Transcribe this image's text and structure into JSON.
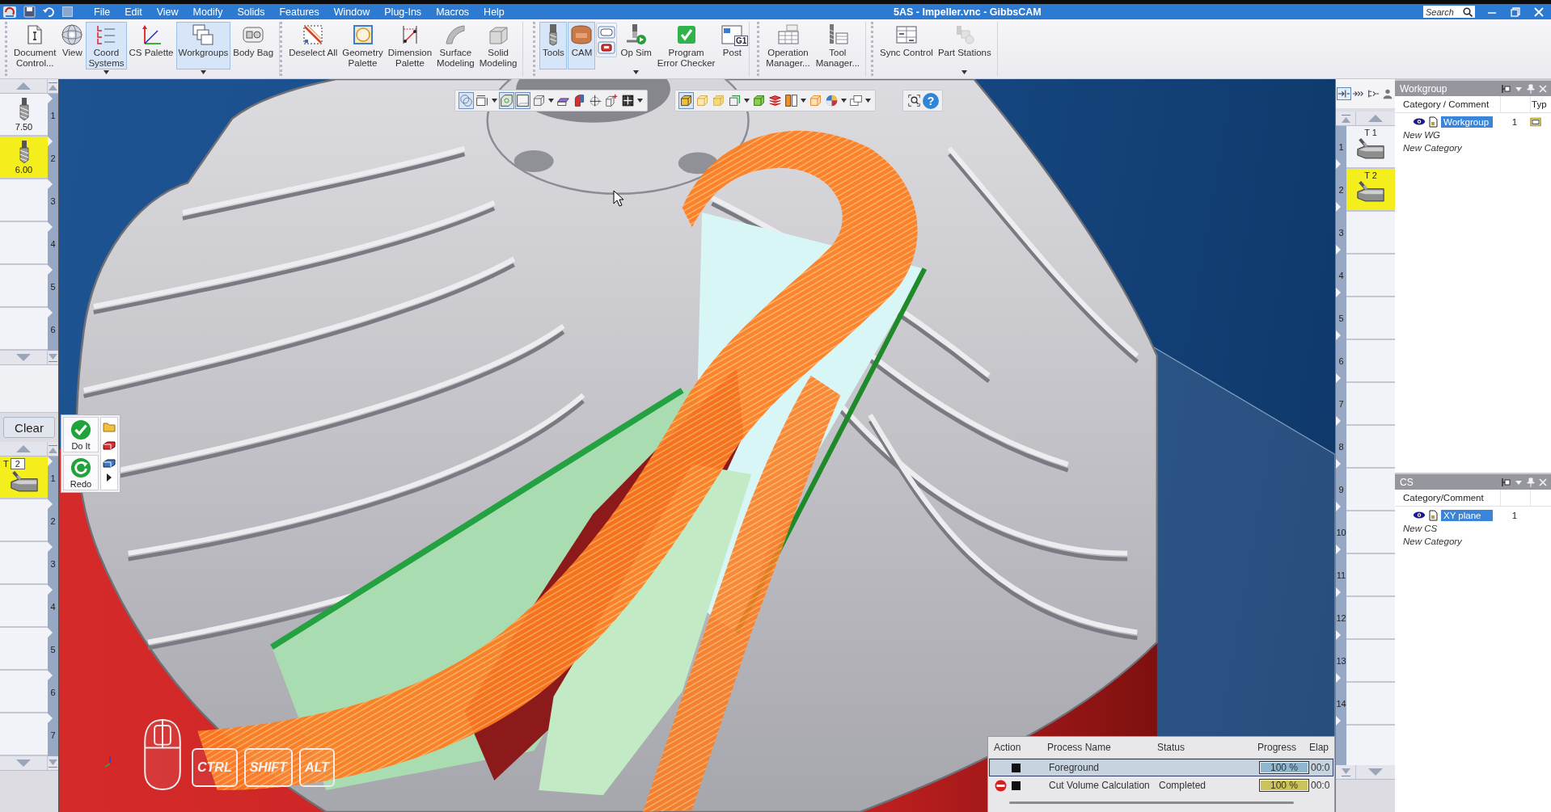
{
  "title_bar": {
    "menu": [
      "File",
      "Edit",
      "View",
      "Modify",
      "Solids",
      "Features",
      "Window",
      "Plug-Ins",
      "Macros",
      "Help"
    ],
    "title": "5AS - Impeller.vnc - GibbsCAM",
    "search": {
      "placeholder": "Search"
    }
  },
  "ribbon": {
    "groups": [
      {
        "items": [
          {
            "kind": "button",
            "label": "Document\nControl...",
            "on": false,
            "dropdown": false
          },
          {
            "kind": "button",
            "label": "View",
            "on": false,
            "dropdown": false
          },
          {
            "kind": "button",
            "label": "Coord\nSystems",
            "on": true,
            "dropdown": true
          },
          {
            "kind": "button",
            "label": "CS Palette",
            "on": false,
            "dropdown": false
          },
          {
            "kind": "button",
            "label": "Workgroups",
            "on": true,
            "dropdown": true
          },
          {
            "kind": "button",
            "label": "Body Bag",
            "on": false,
            "dropdown": false
          }
        ]
      },
      {
        "items": [
          {
            "kind": "button",
            "label": "Deselect All",
            "on": false,
            "dropdown": false
          },
          {
            "kind": "button",
            "label": "Geometry\nPalette",
            "on": false,
            "dropdown": false
          },
          {
            "kind": "button",
            "label": "Dimension\nPalette",
            "on": false,
            "dropdown": false
          },
          {
            "kind": "button",
            "label": "Surface\nModeling",
            "on": false,
            "dropdown": false
          },
          {
            "kind": "button",
            "label": "Solid\nModeling",
            "on": false,
            "dropdown": false
          }
        ]
      },
      {
        "items": [
          {
            "kind": "button",
            "label": "Tools",
            "on": true,
            "dropdown": false
          },
          {
            "kind": "button",
            "label": "CAM",
            "on": true,
            "dropdown": false
          },
          {
            "kind": "icon_stack",
            "on": false,
            "dropdown": false
          },
          {
            "kind": "button",
            "label": "Op Sim",
            "on": false,
            "dropdown": true
          },
          {
            "kind": "button",
            "label": "Program\nError Checker",
            "on": false,
            "dropdown": false
          },
          {
            "kind": "button",
            "label": "Post",
            "badge": "G1",
            "on": false,
            "dropdown": false
          }
        ]
      },
      {
        "items": [
          {
            "kind": "button",
            "label": "Operation\nManager...",
            "on": false,
            "dropdown": false
          },
          {
            "kind": "button",
            "label": "Tool\nManager...",
            "on": false,
            "dropdown": false
          }
        ]
      },
      {
        "items": [
          {
            "kind": "button",
            "label": "Sync Control",
            "on": false,
            "dropdown": false
          },
          {
            "kind": "button",
            "label": "Part Stations",
            "on": false,
            "dropdown": true
          }
        ]
      }
    ]
  },
  "tool_list": {
    "items": [
      {
        "kind": "tool",
        "number": "1",
        "diameter": "7.50",
        "selected": false
      },
      {
        "kind": "tool",
        "number": "2",
        "diameter": "6.00",
        "selected": true
      },
      {
        "kind": "empty",
        "number": "3",
        "selected": false
      },
      {
        "kind": "empty",
        "number": "4",
        "selected": false
      },
      {
        "kind": "empty",
        "number": "5",
        "selected": false
      },
      {
        "kind": "empty",
        "number": "6",
        "selected": false
      }
    ]
  },
  "clear_button": {
    "label": "Clear"
  },
  "action_palette": {
    "buttons": [
      {
        "label": "Do It"
      },
      {
        "label": "Redo"
      }
    ]
  },
  "operation_list": {
    "items": [
      {
        "kind": "operation",
        "number": "1",
        "tool_prefix": "T",
        "tool_number": "2",
        "selected": true
      },
      {
        "kind": "empty",
        "number": "2",
        "selected": false
      },
      {
        "kind": "empty",
        "number": "3",
        "selected": false
      },
      {
        "kind": "empty",
        "number": "4",
        "selected": false
      },
      {
        "kind": "empty",
        "number": "5",
        "selected": false
      },
      {
        "kind": "empty",
        "number": "6",
        "selected": false
      },
      {
        "kind": "empty",
        "number": "7",
        "selected": false
      }
    ]
  },
  "viewport": {
    "view_toolbar": {
      "groups": [
        {
          "items": [
            {
              "kind": "icon",
              "on": true,
              "dropdown": false
            },
            {
              "kind": "icon",
              "on": false,
              "dropdown": true
            },
            {
              "kind": "icon",
              "on": true,
              "dropdown": false
            },
            {
              "kind": "icon",
              "on": true,
              "dropdown": false
            },
            {
              "kind": "icon",
              "on": false,
              "dropdown": true
            },
            {
              "kind": "icon",
              "on": false,
              "dropdown": false
            },
            {
              "kind": "icon",
              "on": false,
              "dropdown": false
            },
            {
              "kind": "icon",
              "on": false,
              "dropdown": false
            },
            {
              "kind": "icon",
              "on": false,
              "dropdown": false
            },
            {
              "kind": "icon",
              "on": false,
              "dropdown": true
            }
          ]
        },
        {
          "items": [
            {
              "kind": "icon",
              "on": true,
              "dropdown": false
            },
            {
              "kind": "icon",
              "on": false,
              "dropdown": false
            },
            {
              "kind": "icon",
              "on": false,
              "dropdown": false
            },
            {
              "kind": "icon",
              "on": false,
              "dropdown": true
            },
            {
              "kind": "icon",
              "on": false,
              "dropdown": false
            },
            {
              "kind": "icon",
              "on": false,
              "dropdown": false
            },
            {
              "kind": "icon",
              "on": false,
              "dropdown": true
            },
            {
              "kind": "icon",
              "on": false,
              "dropdown": false
            },
            {
              "kind": "icon",
              "on": false,
              "dropdown": true
            },
            {
              "kind": "icon",
              "on": false,
              "dropdown": true
            }
          ]
        },
        {
          "items": [
            {
              "kind": "icon",
              "on": false,
              "dropdown": false
            },
            {
              "kind": "label",
              "label": "?",
              "on": false,
              "dropdown": false
            }
          ]
        }
      ]
    },
    "modifier_keys": [
      "CTRL",
      "SHIFT",
      "ALT"
    ],
    "process_table": {
      "columns": [
        "Action",
        "Process Name",
        "Status",
        "Progress",
        "Elap"
      ],
      "rows": [
        {
          "stoppable": false,
          "process_name": "Foreground",
          "progress": "100 %",
          "level": 1,
          "color": "#8fb7cf",
          "elapsed": "00:0",
          "selected": true
        },
        {
          "stoppable": true,
          "process_name": "Cut Volume Calculation",
          "status": "Completed",
          "progress": "100 %",
          "level": 1,
          "color": "#cbc35a",
          "elapsed": "00:0",
          "selected": false
        }
      ]
    }
  },
  "tool_strip": {
    "buttons": [
      {
        "on": true
      },
      {
        "on": false
      },
      {
        "on": false
      },
      {
        "on": false
      }
    ],
    "items": [
      {
        "kind": "tool",
        "number": "1",
        "label": "T 1",
        "selected": false
      },
      {
        "kind": "tool",
        "number": "2",
        "label": "T 2",
        "selected": true
      },
      {
        "kind": "empty",
        "number": "3",
        "selected": false
      },
      {
        "kind": "empty",
        "number": "4",
        "selected": false
      },
      {
        "kind": "empty",
        "number": "5",
        "selected": false
      },
      {
        "kind": "empty",
        "number": "6",
        "selected": false
      },
      {
        "kind": "empty",
        "number": "7",
        "selected": false
      },
      {
        "kind": "empty",
        "number": "8",
        "selected": false
      },
      {
        "kind": "empty",
        "number": "9",
        "selected": false
      },
      {
        "kind": "empty",
        "number": "10",
        "selected": false
      },
      {
        "kind": "empty",
        "number": "11",
        "selected": false
      },
      {
        "kind": "empty",
        "number": "12",
        "selected": false
      },
      {
        "kind": "empty",
        "number": "13",
        "selected": false
      },
      {
        "kind": "empty",
        "number": "14",
        "selected": false
      }
    ]
  },
  "workgroup_panel": {
    "title": "Workgroup",
    "columns": [
      "Category / Comment",
      "Typ"
    ],
    "rows": [
      {
        "name": "Workgroup",
        "count": "1",
        "selected": true
      }
    ],
    "actions": [
      "New WG",
      "New Category"
    ]
  },
  "cs_panel": {
    "title": "CS",
    "columns": [
      "Category/Comment"
    ],
    "rows": [
      {
        "name": "XY plane",
        "count": "1",
        "selected": true
      }
    ],
    "actions": [
      "New CS",
      "New Category"
    ]
  }
}
